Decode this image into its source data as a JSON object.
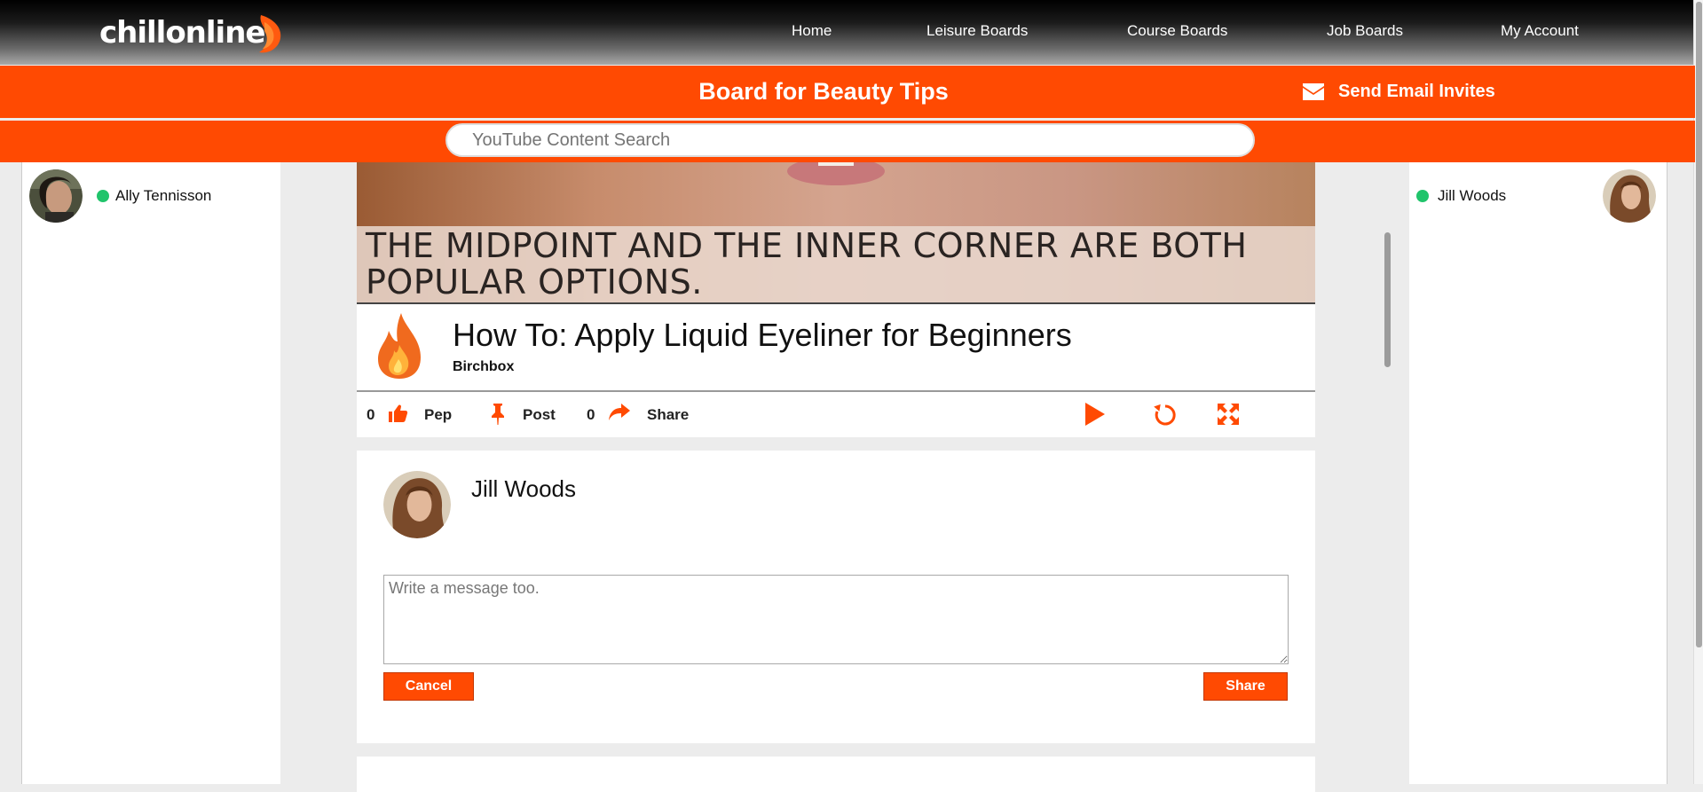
{
  "app": {
    "logo_text": "chillonline"
  },
  "nav": {
    "items": [
      {
        "label": "Home"
      },
      {
        "label": "Leisure Boards"
      },
      {
        "label": "Course Boards"
      },
      {
        "label": "Job Boards"
      },
      {
        "label": "My Account"
      }
    ]
  },
  "board": {
    "title": "Board for Beauty Tips",
    "invite_label": "Send Email Invites",
    "invite_icon": "envelope-icon"
  },
  "search": {
    "placeholder": "YouTube Content Search",
    "value": ""
  },
  "left_panel": {
    "users": [
      {
        "name": "Ally Tennisson",
        "status": "online"
      }
    ]
  },
  "right_panel": {
    "users": [
      {
        "name": "Jill Woods",
        "status": "online"
      }
    ]
  },
  "video": {
    "caption": "THE MIDPOINT AND THE INNER CORNER ARE BOTH POPULAR OPTIONS.",
    "title": "How To: Apply Liquid Eyeliner for Beginners",
    "channel": "Birchbox"
  },
  "actions": {
    "pep_count": "0",
    "pep_label": "Pep",
    "post_label": "Post",
    "share_count": "0",
    "share_label": "Share",
    "play_icon": "play-icon",
    "replay_icon": "replay-icon",
    "fullscreen_icon": "fullscreen-icon"
  },
  "share_form": {
    "user_name": "Jill Woods",
    "message_placeholder": "Write a message too.",
    "message_value": "",
    "cancel_label": "Cancel",
    "share_label": "Share"
  },
  "colors": {
    "brand_orange": "#ff4a02",
    "online_green": "#20c46b",
    "nav_black": "#000000"
  }
}
